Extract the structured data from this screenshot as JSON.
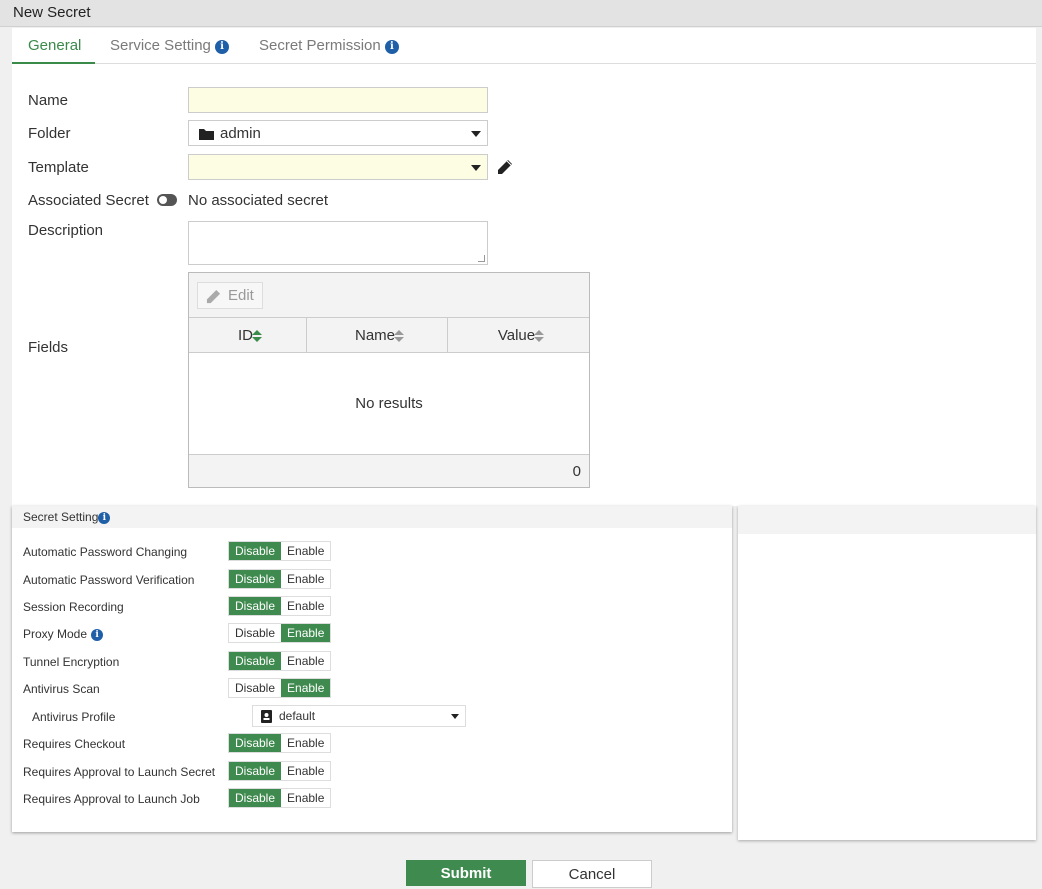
{
  "window": {
    "title": "New Secret"
  },
  "tabs": [
    {
      "label": "General",
      "active": true
    },
    {
      "label": "Service Setting",
      "info": true
    },
    {
      "label": "Secret Permission",
      "info": true
    }
  ],
  "form": {
    "name_label": "Name",
    "name_value": "",
    "folder_label": "Folder",
    "folder_value": "admin",
    "template_label": "Template",
    "template_value": "",
    "associated_label": "Associated Secret",
    "associated_value": "No associated secret",
    "description_label": "Description",
    "fields_label": "Fields"
  },
  "fields_table": {
    "edit_label": "Edit",
    "columns": [
      "ID",
      "Name",
      "Value"
    ],
    "empty_text": "No results",
    "count": "0"
  },
  "secret_setting": {
    "title": "Secret Setting",
    "rows": [
      {
        "label": "Automatic Password Changing",
        "value": "Disable"
      },
      {
        "label": "Automatic Password Verification",
        "value": "Disable"
      },
      {
        "label": "Session Recording",
        "value": "Disable"
      },
      {
        "label": "Proxy Mode",
        "value": "Enable",
        "info": true
      },
      {
        "label": "Tunnel Encryption",
        "value": "Disable"
      },
      {
        "label": "Antivirus Scan",
        "value": "Enable"
      },
      {
        "label": "Requires Checkout",
        "value": "Disable"
      },
      {
        "label": "Requires Approval to Launch Secret",
        "value": "Disable"
      },
      {
        "label": "Requires Approval to Launch Job",
        "value": "Disable"
      }
    ],
    "disable_label": "Disable",
    "enable_label": "Enable",
    "antivirus_profile_label": "Antivirus Profile",
    "antivirus_profile_value": "default"
  },
  "buttons": {
    "submit": "Submit",
    "cancel": "Cancel"
  },
  "colors": {
    "accent": "#3f8a4e",
    "info": "#1f5fa8",
    "required_bg": "#fdfde3"
  }
}
